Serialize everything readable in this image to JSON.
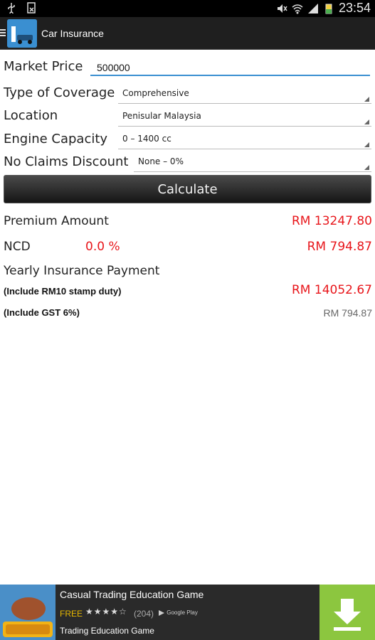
{
  "statusbar": {
    "time": "23:54"
  },
  "app": {
    "title": "Car Insurance"
  },
  "form": {
    "market_price_label": "Market Price",
    "market_price_value": "500000",
    "coverage_label": "Type of Coverage",
    "coverage_value": "Comprehensive",
    "location_label": "Location",
    "location_value": "Penisular Malaysia",
    "engine_label": "Engine Capacity",
    "engine_value": "0 – 1400 cc",
    "ncd_label": "No Claims Discount",
    "ncd_value": "None – 0%",
    "calculate_label": "Calculate"
  },
  "results": {
    "premium_label": "Premium Amount",
    "premium_value": "RM 13247.80",
    "ncd_label": "NCD",
    "ncd_percent": "0.0 %",
    "ncd_value": "RM 794.87",
    "yearly_label": "Yearly Insurance Payment",
    "stamp_note": "(Include RM10 stamp duty)",
    "yearly_value": "RM 14052.67",
    "gst_note": "(Include GST 6%)",
    "gst_value": "RM 794.87"
  },
  "ad": {
    "title": "Casual Trading Education Game",
    "price": "FREE",
    "stars": "★★★★☆",
    "rating_count": "(204)",
    "store": "Google Play",
    "subtitle": "Trading Education Game"
  },
  "colors": {
    "accent": "#3a8fd1",
    "value_red": "#e8161b",
    "download_green": "#8cc63f"
  }
}
